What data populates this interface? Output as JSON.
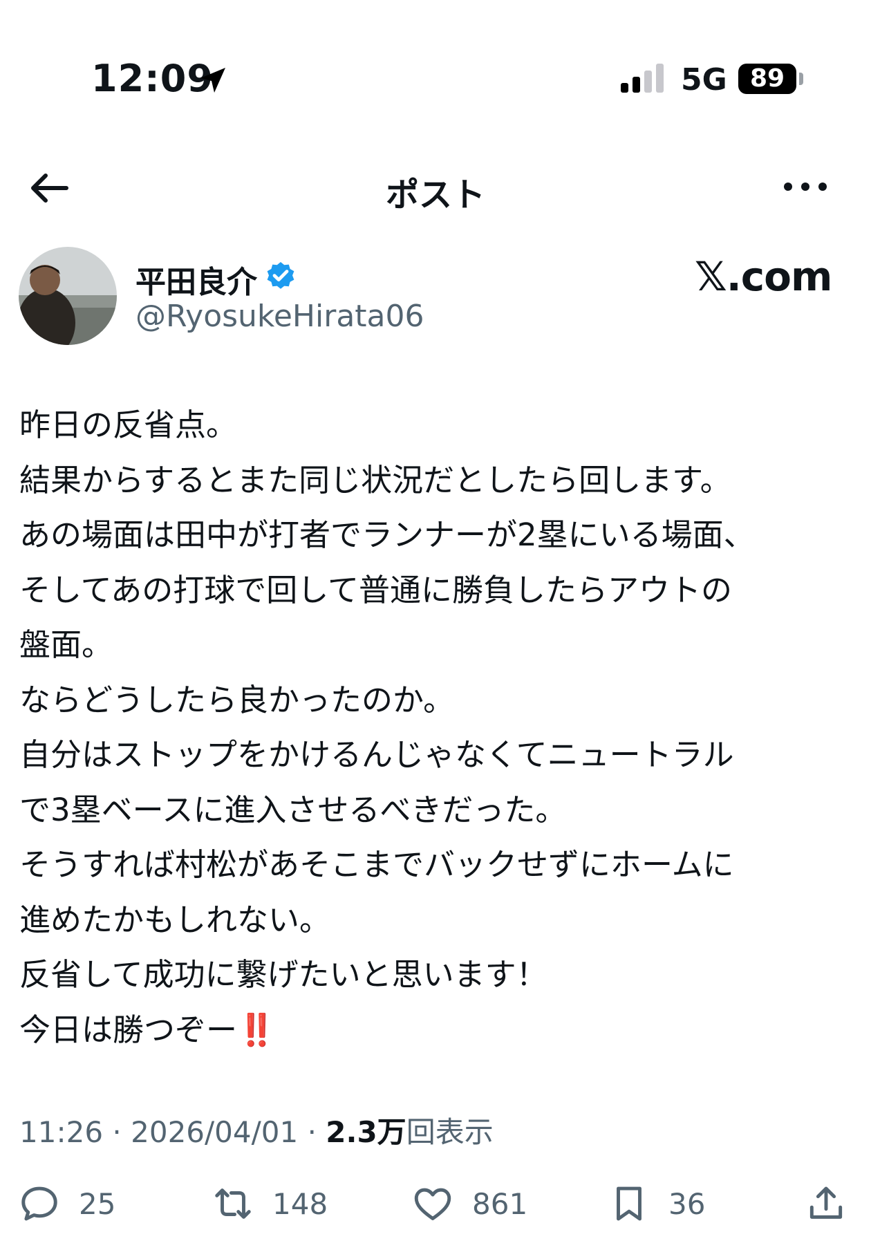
{
  "status": {
    "time": "12:09",
    "network": "5G",
    "battery": "89"
  },
  "nav": {
    "title": "ポスト"
  },
  "author": {
    "name": "平田良介",
    "handle": "@RyosukeHirata06",
    "watermark": "𝕏.com"
  },
  "post": {
    "lines": [
      "昨日の反省点。",
      "結果からするとまた同じ状況だとしたら回します。",
      "あの場面は田中が打者でランナーが2塁にいる場面、",
      "そしてあの打球で回して普通に勝負したらアウトの",
      "盤面。",
      "ならどうしたら良かったのか。",
      "自分はストップをかけるんじゃなくてニュートラル",
      "で3塁ベースに進入させるべきだった。",
      "そうすれば村松があそこまでバックせずにホームに",
      "進めたかもしれない。",
      "反省して成功に繋げたいと思います！",
      "今日は勝つぞー"
    ],
    "final_emoji": "‼️"
  },
  "meta": {
    "time": "11:26",
    "separator": "·",
    "date": "2026/04/01",
    "views": "2.3万",
    "views_label": "回表示"
  },
  "actions": {
    "replies": "25",
    "reposts": "148",
    "likes": "861",
    "bookmarks": "36"
  },
  "colors": {
    "text": "#0f1419",
    "secondary": "#536471",
    "verified": "#1d9bf0",
    "emoji": "#d8241f"
  }
}
